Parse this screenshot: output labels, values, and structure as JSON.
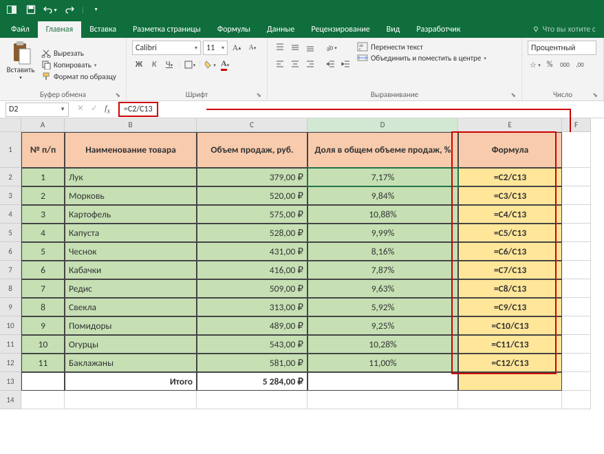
{
  "qat": {
    "save": "save",
    "undo": "undo",
    "redo": "redo"
  },
  "menu": {
    "tabs": [
      "Файл",
      "Главная",
      "Вставка",
      "Разметка страницы",
      "Формулы",
      "Данные",
      "Рецензирование",
      "Вид",
      "Разработчик"
    ],
    "active": 1,
    "tell": "Что вы хотите с"
  },
  "ribbon": {
    "clipboard": {
      "paste": "Вставить",
      "cut": "Вырезать",
      "copy": "Копировать",
      "painter": "Формат по образцу",
      "label": "Буфер обмена"
    },
    "font": {
      "name": "Calibri",
      "size": "11",
      "label": "Шрифт",
      "bold": "Ж",
      "italic": "К",
      "underline": "Ч"
    },
    "align": {
      "label": "Выравнивание",
      "wrap": "Перенести текст",
      "merge": "Объединить и поместить в центре"
    },
    "number": {
      "label": "Число",
      "format": "Процентный"
    }
  },
  "fbar": {
    "name": "D2",
    "formula": "=C2/C13"
  },
  "cols": [
    "A",
    "B",
    "C",
    "D",
    "E",
    "F"
  ],
  "headers": {
    "A": "№ п/п",
    "B": "Наименование товара",
    "C": "Объем продаж, руб.",
    "D": "Доля в общем объеме продаж, %",
    "E": "Формула"
  },
  "rows": [
    {
      "n": "1",
      "name": "Лук",
      "vol": "379,00 ₽",
      "share": "7,17%",
      "f": "=C2/C13"
    },
    {
      "n": "2",
      "name": "Морковь",
      "vol": "520,00 ₽",
      "share": "9,84%",
      "f": "=C3/C13"
    },
    {
      "n": "3",
      "name": "Картофель",
      "vol": "575,00 ₽",
      "share": "10,88%",
      "f": "=C4/C13"
    },
    {
      "n": "4",
      "name": "Капуста",
      "vol": "528,00 ₽",
      "share": "9,99%",
      "f": "=C5/C13"
    },
    {
      "n": "5",
      "name": "Чеснок",
      "vol": "431,00 ₽",
      "share": "8,16%",
      "f": "=C6/C13"
    },
    {
      "n": "6",
      "name": "Кабачки",
      "vol": "416,00 ₽",
      "share": "7,87%",
      "f": "=C7/C13"
    },
    {
      "n": "7",
      "name": "Редис",
      "vol": "509,00 ₽",
      "share": "9,63%",
      "f": "=C8/C13"
    },
    {
      "n": "8",
      "name": "Свекла",
      "vol": "313,00 ₽",
      "share": "5,92%",
      "f": "=C9/C13"
    },
    {
      "n": "9",
      "name": "Помидоры",
      "vol": "489,00 ₽",
      "share": "9,25%",
      "f": "=C10/C13"
    },
    {
      "n": "10",
      "name": "Огурцы",
      "vol": "543,00 ₽",
      "share": "10,28%",
      "f": "=C11/C13"
    },
    {
      "n": "11",
      "name": "Баклажаны",
      "vol": "581,00 ₽",
      "share": "11,00%",
      "f": "=C12/C13"
    }
  ],
  "total": {
    "label": "Итого",
    "value": "5 284,00 ₽"
  },
  "rowNums": [
    "1",
    "2",
    "3",
    "4",
    "5",
    "6",
    "7",
    "8",
    "9",
    "10",
    "11",
    "12",
    "13",
    "14"
  ]
}
